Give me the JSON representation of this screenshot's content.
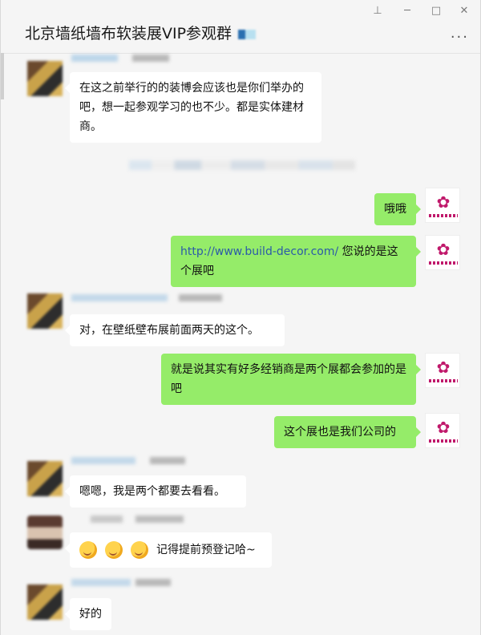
{
  "window": {
    "title": "北京墙纸墙布软装展VIP参观群",
    "controls": {
      "pin": "⊥",
      "minimize": "─",
      "maximize": "□",
      "close": "✕"
    },
    "more_icon": "more-dots-icon"
  },
  "messages": [
    {
      "side": "left",
      "text": "在这之前举行的的装博会应该也是你们举办的吧，想一起参观学习的也不少。都是实体建材商。"
    },
    {
      "side": "right",
      "text": "哦哦"
    },
    {
      "side": "right",
      "link": "http://www.build-decor.com/",
      "text": " 您说的是这个展吧"
    },
    {
      "side": "left",
      "text": "对，在壁纸壁布展前面两天的这个。"
    },
    {
      "side": "right",
      "text": "就是说其实有好多经销商是两个展都会参加的是吧"
    },
    {
      "side": "right",
      "text": "这个展也是我们公司的"
    },
    {
      "side": "left",
      "text": "嗯嗯，我是两个都要去看看。"
    },
    {
      "side": "left",
      "text": "记得提前预登记哈~"
    },
    {
      "side": "left",
      "text": "好的"
    }
  ]
}
